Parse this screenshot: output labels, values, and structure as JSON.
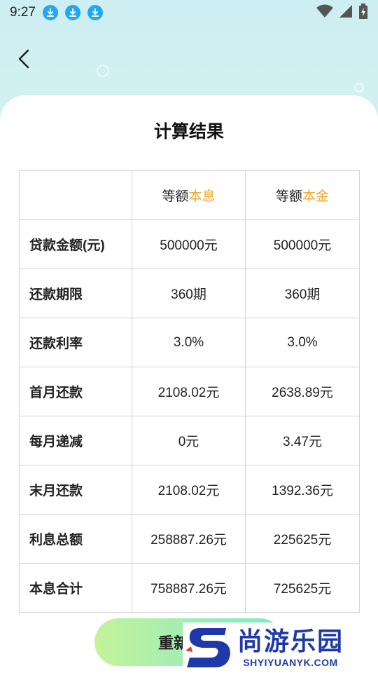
{
  "status_bar": {
    "time": "9:27"
  },
  "page": {
    "title": "计算结果"
  },
  "table": {
    "columns": [
      {
        "prefix": "等额",
        "accent": "本息"
      },
      {
        "prefix": "等额",
        "accent": "本金"
      }
    ],
    "rows": [
      {
        "label": "贷款金额(元)",
        "a": "500000元",
        "b": "500000元"
      },
      {
        "label": "还款期限",
        "a": "360期",
        "b": "360期"
      },
      {
        "label": "还款利率",
        "a": "3.0%",
        "b": "3.0%"
      },
      {
        "label": "首月还款",
        "a": "2108.02元",
        "b": "2638.89元"
      },
      {
        "label": "每月递减",
        "a": "0元",
        "b": "3.47元"
      },
      {
        "label": "末月还款",
        "a": "2108.02元",
        "b": "1392.36元"
      },
      {
        "label": "利息总额",
        "a": "258887.26元",
        "b": "225625元"
      },
      {
        "label": "本息合计",
        "a": "758887.26元",
        "b": "725625元"
      }
    ]
  },
  "button": {
    "label": "重新计算"
  },
  "watermark": {
    "cn": "尚游乐园",
    "en": "SHYIYUANYK.COM"
  },
  "colors": {
    "accent": "#f5a623",
    "download_badge": "#21a8f0",
    "brand_blue": "#1f3aa8"
  },
  "icons": [
    "back-arrow-icon",
    "download-icon",
    "wifi-icon",
    "signal-icon",
    "battery-icon"
  ]
}
